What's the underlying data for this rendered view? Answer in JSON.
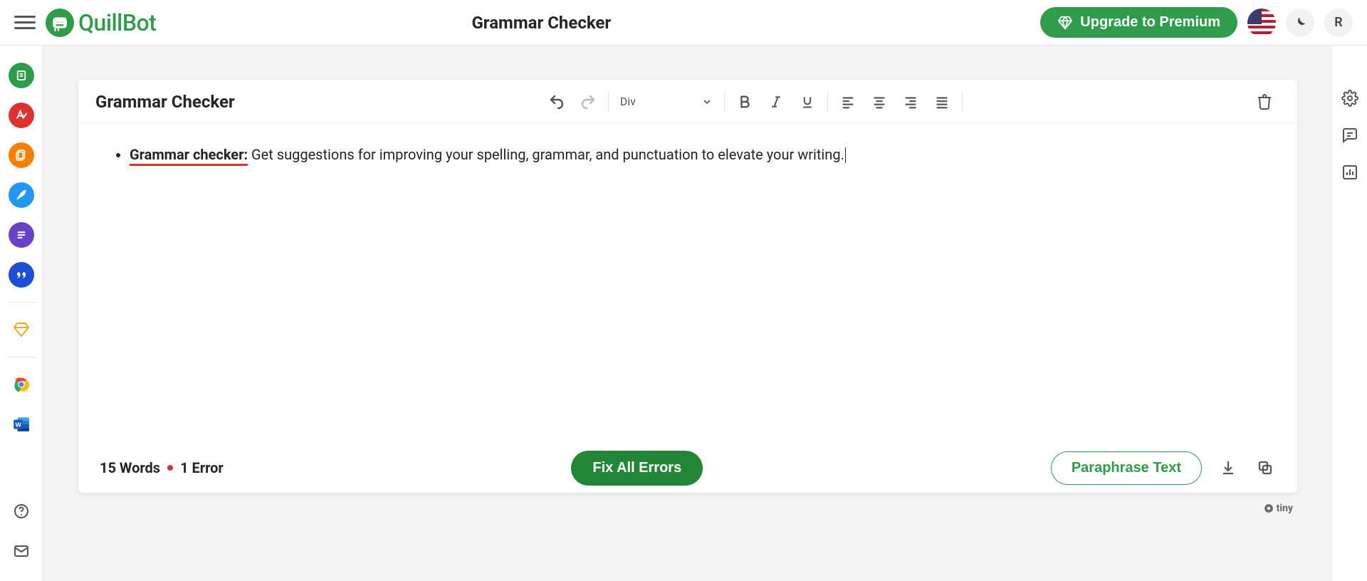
{
  "header": {
    "app_title": "Grammar Checker",
    "logo_text": "QuillBot",
    "upgrade_label": "Upgrade to Premium",
    "avatar_initial": "R"
  },
  "left_rail": {
    "items": [
      {
        "name": "paraphraser-icon",
        "bg": "#2e9c4b"
      },
      {
        "name": "grammar-checker-icon",
        "bg": "#e03131"
      },
      {
        "name": "plagiarism-icon",
        "bg": "#f77f00"
      },
      {
        "name": "cowriter-icon",
        "bg": "#2196f3"
      },
      {
        "name": "summarizer-icon",
        "bg": "#6941c6"
      },
      {
        "name": "citation-icon",
        "bg": "#1d4ed8"
      }
    ],
    "premium_name": "premium-diamond-icon"
  },
  "editor": {
    "card_title": "Grammar Checker",
    "format_block": "Div",
    "content": {
      "bold_error": "Grammar checker:",
      "rest": " Get suggestions for improving your spelling, grammar, and punctuation to elevate your writing."
    }
  },
  "footer": {
    "word_count_label": "15 Words",
    "error_count_label": "1 Error",
    "fix_label": "Fix All Errors",
    "paraphrase_label": "Paraphrase Text"
  },
  "tiny_label": "tiny"
}
